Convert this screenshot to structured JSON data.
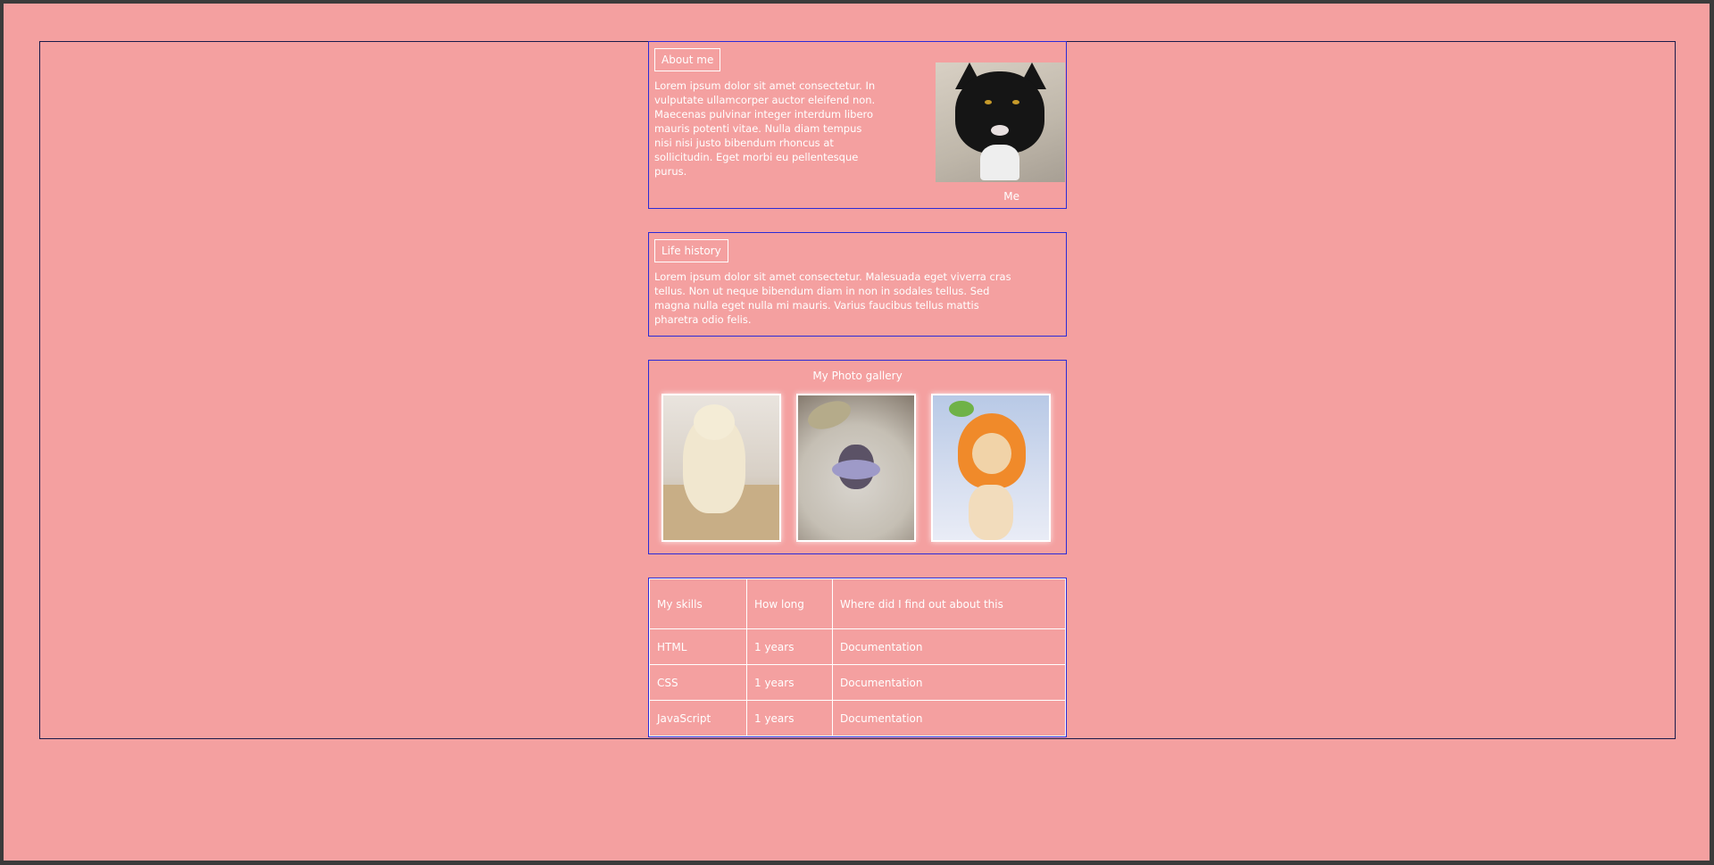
{
  "about": {
    "heading": "About me",
    "text": "Lorem ipsum dolor sit amet consectetur. In vulputate ullamcorper auctor eleifend non. Maecenas pulvinar integer interdum libero mauris potenti vitae. Nulla diam tempus nisi nisi justo bibendum rhoncus at sollicitudin. Eget morbi eu pellentesque purus.",
    "photo_caption": "Me"
  },
  "life": {
    "heading": "Life history",
    "text": "Lorem ipsum dolor sit amet consectetur. Malesuada eget viverra cras tellus. Non ut neque bibendum diam in non in sodales tellus. Sed magna nulla eget nulla mi mauris. Varius faucibus tellus mattis pharetra odio felis."
  },
  "gallery": {
    "title": "My Photo gallery"
  },
  "skills": {
    "headers": [
      "My skills",
      "How long",
      "Where did I find out about this"
    ],
    "rows": [
      [
        "HTML",
        "1 years",
        "Documentation"
      ],
      [
        "CSS",
        "1 years",
        "Documentation"
      ],
      [
        "JavaScript",
        "1 years",
        "Documentation"
      ]
    ]
  }
}
